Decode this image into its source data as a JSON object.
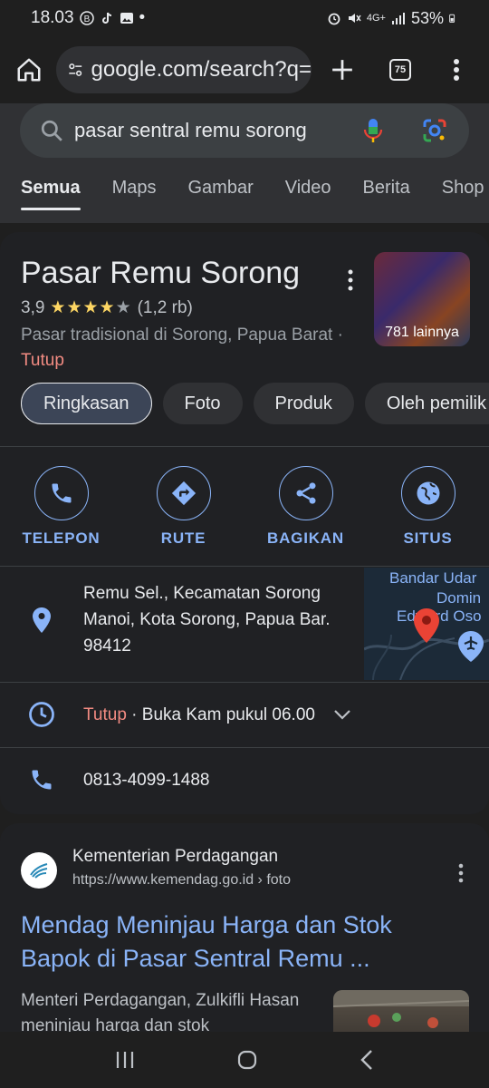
{
  "status_bar": {
    "time": "18.03",
    "battery": "53%",
    "network": "4G+"
  },
  "browser": {
    "url": "google.com/search?q=",
    "tab_count": "75"
  },
  "search": {
    "query": "pasar sentral remu sorong",
    "tabs": [
      "Semua",
      "Maps",
      "Gambar",
      "Video",
      "Berita",
      "Shop"
    ]
  },
  "place": {
    "name": "Pasar Remu Sorong",
    "rating": "3,9",
    "stars": "★★★★",
    "star_dim": "★",
    "reviews": "(1,2 rb)",
    "category": "Pasar tradisional di Sorong, Papua Barat",
    "dot": " · ",
    "status": "Tutup",
    "photo_more": "781 lainnya",
    "chips": [
      "Ringkasan",
      "Foto",
      "Produk",
      "Oleh pemilik"
    ],
    "actions": [
      "TELEPON",
      "RUTE",
      "BAGIKAN",
      "SITUS"
    ],
    "address": "Remu Sel., Kecamatan Sorong Manoi, Kota Sorong, Papua Bar. 98412",
    "hours_status": "Tutup",
    "hours_detail": " · Buka Kam pukul 06.00",
    "phone": "0813-4099-1488",
    "map_labels": [
      "Bandar Udar",
      "Domin",
      "Edward Oso"
    ]
  },
  "result": {
    "site": "Kementerian Perdagangan",
    "url": "https://www.kemendag.go.id › foto",
    "title": "Mendag Meninjau Harga dan Stok Bapok di Pasar Sentral Remu ...",
    "snippet": "Menteri Perdagangan, Zulkifli Hasan meninjau harga dan stok"
  },
  "colors": {
    "accent": "#8ab4f8",
    "closed": "#f28b82",
    "star": "#fdd663"
  }
}
